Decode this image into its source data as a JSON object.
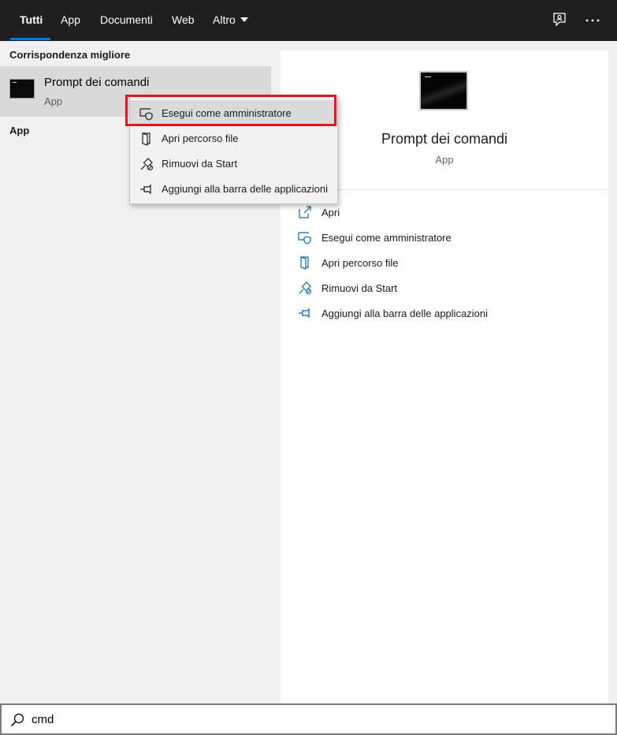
{
  "tabs": [
    {
      "label": "Tutti",
      "active": true
    },
    {
      "label": "App"
    },
    {
      "label": "Documenti"
    },
    {
      "label": "Web"
    },
    {
      "label": "Altro"
    }
  ],
  "left": {
    "best_match_title": "Corrispondenza migliore",
    "best_match": {
      "name": "Prompt dei comandi",
      "type": "App",
      "icon": "command-prompt-icon"
    },
    "apps_title": "App"
  },
  "context_menu": {
    "items": [
      {
        "label": "Esegui come amministratore",
        "icon": "shield-icon",
        "highlighted": true
      },
      {
        "label": "Apri percorso file",
        "icon": "folder-icon"
      },
      {
        "label": "Rimuovi da Start",
        "icon": "unpin-icon"
      },
      {
        "label": "Aggiungi alla barra delle applicazioni",
        "icon": "pin-icon"
      }
    ]
  },
  "details": {
    "name": "Prompt dei comandi",
    "type": "App",
    "actions": [
      {
        "label": "Apri",
        "icon": "open-icon"
      },
      {
        "label": "Esegui come amministratore",
        "icon": "shield-icon"
      },
      {
        "label": "Apri percorso file",
        "icon": "folder-icon"
      },
      {
        "label": "Rimuovi da Start",
        "icon": "unpin-icon"
      },
      {
        "label": "Aggiungi alla barra delle applicazioni",
        "icon": "pin-icon"
      }
    ]
  },
  "search": {
    "value": "cmd"
  },
  "colors": {
    "accent": "#0078d7",
    "highlight_border": "#e8141c",
    "topbar": "#1f1f1f"
  }
}
